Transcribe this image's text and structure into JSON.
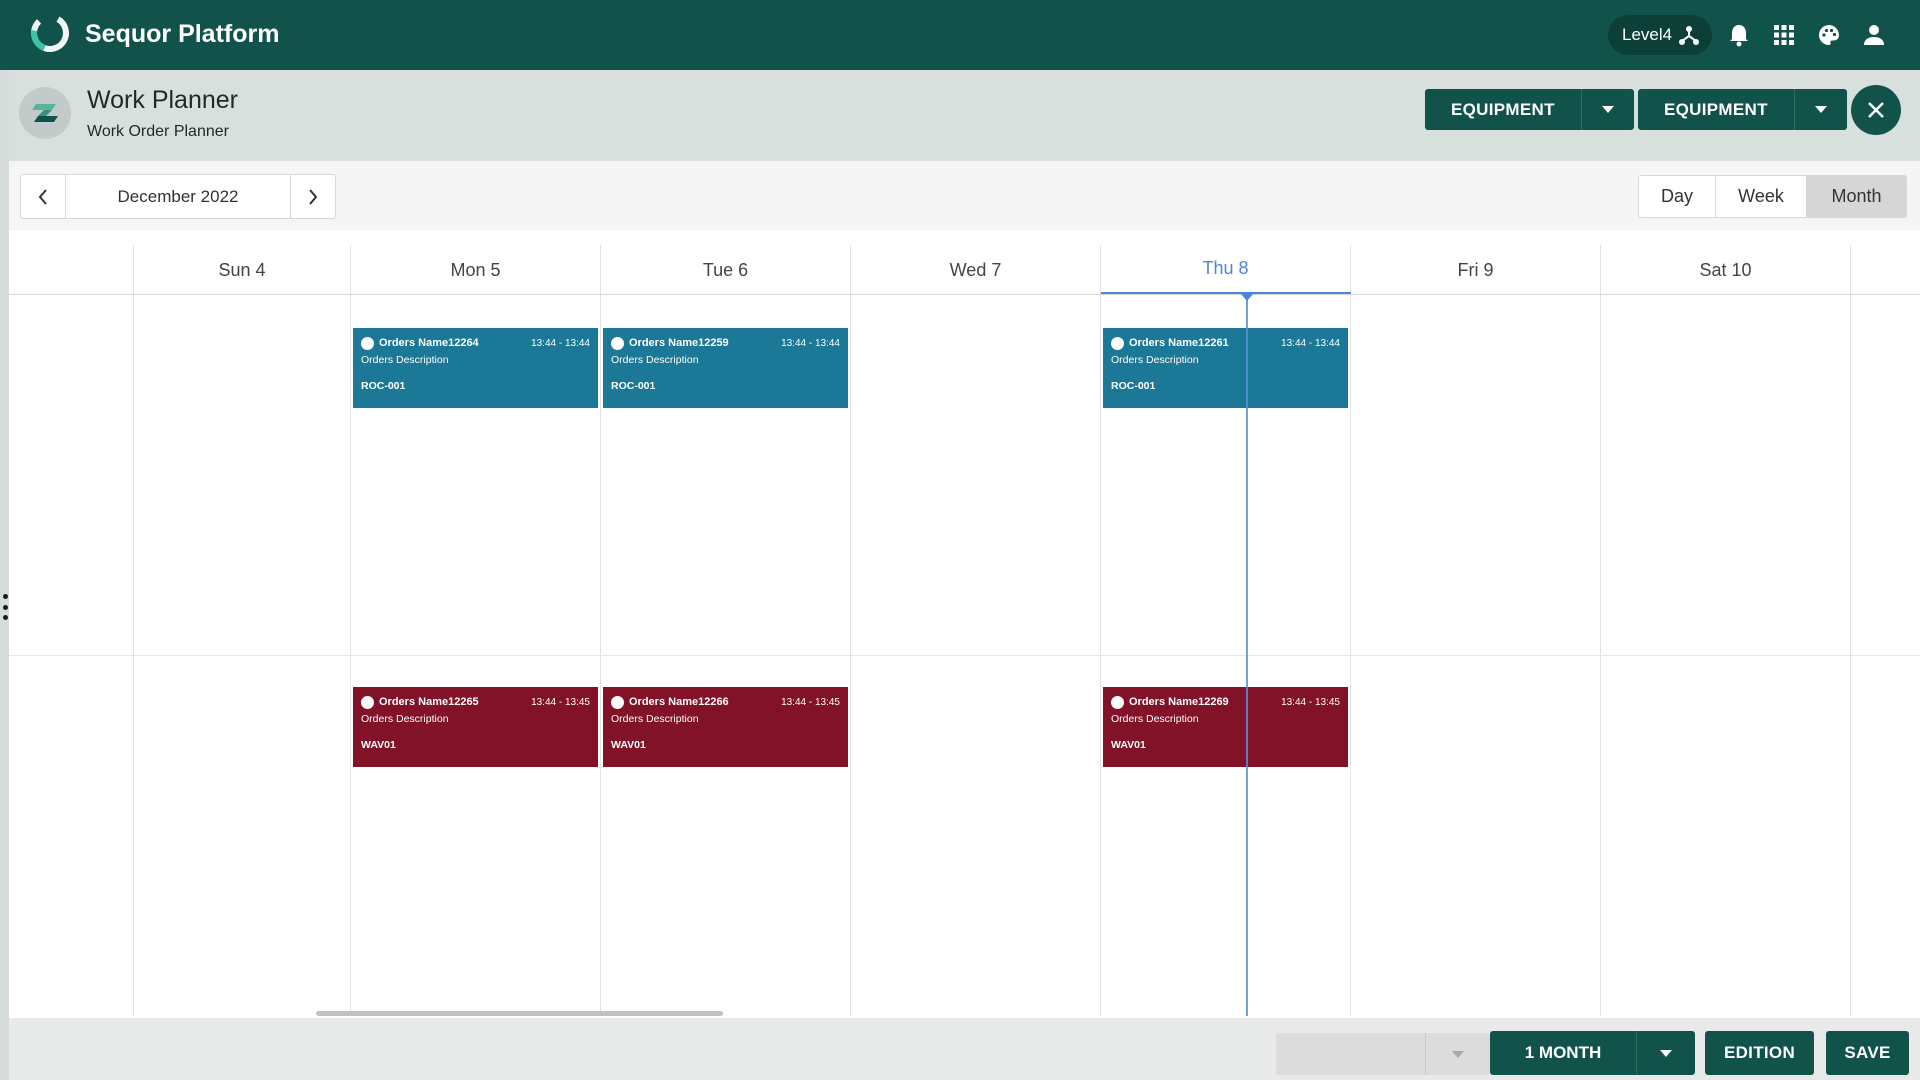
{
  "app": {
    "title": "Sequor Platform",
    "level": "Level4",
    "icons": [
      "network-icon",
      "bell-icon",
      "apps-grid-icon",
      "palette-icon",
      "user-icon"
    ]
  },
  "header": {
    "title": "Work Planner",
    "subtitle": "Work Order Planner",
    "buttons": [
      "EQUIPMENT",
      "EQUIPMENT"
    ]
  },
  "toolbar": {
    "period": "December 2022",
    "views": [
      "Day",
      "Week",
      "Month"
    ],
    "active_view": "Month"
  },
  "calendar": {
    "days": [
      "Sun 4",
      "Mon 5",
      "Tue 6",
      "Wed 7",
      "Thu 8",
      "Fri 9",
      "Sat 10"
    ],
    "today": "Thu 8",
    "events": [
      {
        "name": "Orders Name12264",
        "time": "13:44 - 13:44",
        "desc": "Orders Description",
        "resource": "ROC-001",
        "day": "Mon 5",
        "color": "#1b7896"
      },
      {
        "name": "Orders Name12259",
        "time": "13:44 - 13:44",
        "desc": "Orders Description",
        "resource": "ROC-001",
        "day": "Tue 6",
        "color": "#1b7896"
      },
      {
        "name": "Orders Name12261",
        "time": "13:44 - 13:44",
        "desc": "Orders Description",
        "resource": "ROC-001",
        "day": "Thu 8",
        "color": "#1b7896"
      },
      {
        "name": "Orders Name12265",
        "time": "13:44 - 13:45",
        "desc": "Orders Description",
        "resource": "WAV01",
        "day": "Mon 5",
        "color": "#821228"
      },
      {
        "name": "Orders Name12266",
        "time": "13:44 - 13:45",
        "desc": "Orders Description",
        "resource": "WAV01",
        "day": "Tue 6",
        "color": "#821228"
      },
      {
        "name": "Orders Name12269",
        "time": "13:44 - 13:45",
        "desc": "Orders Description",
        "resource": "WAV01",
        "day": "Thu 8",
        "color": "#821228"
      }
    ]
  },
  "footer": {
    "range": "1 MONTH",
    "edition": "EDITION",
    "save": "SAVE"
  },
  "colors": {
    "primary": "#11524a",
    "today_accent": "#4a86d9",
    "event_blue": "#1b7896",
    "event_red": "#821228"
  }
}
